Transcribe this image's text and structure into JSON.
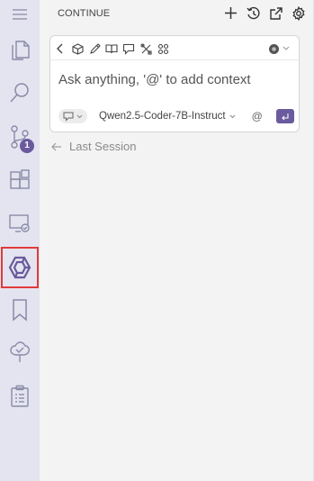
{
  "activity_bar": {
    "items": [
      {
        "name": "menu-icon"
      },
      {
        "name": "explorer-icon"
      },
      {
        "name": "search-icon"
      },
      {
        "name": "source-control-icon",
        "badge": "1"
      },
      {
        "name": "extensions-icon"
      },
      {
        "name": "remote-explorer-icon"
      },
      {
        "name": "continue-logo-icon",
        "selected": true
      },
      {
        "name": "bookmark-icon"
      },
      {
        "name": "testing-icon"
      },
      {
        "name": "clipboard-list-icon"
      }
    ],
    "accent": "#6a5a9c",
    "selected_outline": "#e23a3a"
  },
  "panel": {
    "title": "CONTINUE",
    "header_actions": [
      "plus-icon",
      "history-icon",
      "open-external-icon",
      "settings-icon"
    ]
  },
  "input_card": {
    "toolbar_icons": [
      "chevron-left-icon",
      "cube-icon",
      "pencil-icon",
      "book-icon",
      "comment-icon",
      "tools-icon",
      "grid-icon"
    ],
    "mode_icon": "record-icon",
    "placeholder": "Ask anything, '@' to add context",
    "mode_chip_icon": "chat-bubble-icon",
    "model": "Qwen2.5-Coder-7B-Instruct",
    "at_symbol": "@",
    "send_icon": "enter-icon"
  },
  "last_session": {
    "label": "Last Session"
  }
}
